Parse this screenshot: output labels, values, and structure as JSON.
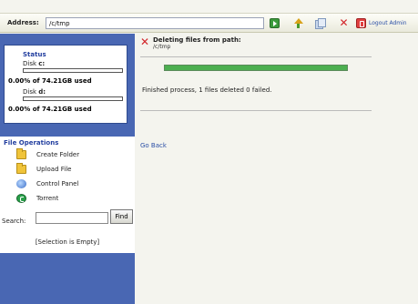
{
  "address": {
    "label": "Address:",
    "value": "/c/tmp",
    "logout_label": "Logout Admin"
  },
  "status": {
    "title": "Status",
    "disks": [
      {
        "label": "Disk ",
        "drive": "c:",
        "used_fraction": 0.0,
        "used_text": "0.00% of 74.21GB  used"
      },
      {
        "label": "Disk ",
        "drive": "d:",
        "used_fraction": 0.0,
        "used_text": "0.00% of 74.21GB  used"
      }
    ]
  },
  "file_operations": {
    "title": "File Operations",
    "items": [
      {
        "label": "Create Folder",
        "icon": "folder-icon"
      },
      {
        "label": "Upload File",
        "icon": "folder-icon"
      },
      {
        "label": "Control Panel",
        "icon": "control-panel-icon"
      },
      {
        "label": "Torrent",
        "icon": "torrent-icon"
      }
    ],
    "search_label": "Search:",
    "search_value": "",
    "find_label": "Find",
    "selection_text": "[Selection is Empty]"
  },
  "main": {
    "title": "Deleting files from path:",
    "path": "/c/tmp",
    "progress": 1.0,
    "message": "Finished process, 1 files deleted 0 failed.",
    "go_back": "Go Back"
  },
  "colors": {
    "sidebar": "#4967b3",
    "progress": "#4caf50",
    "delete": "#d2262a",
    "link": "#2b4fa6"
  }
}
